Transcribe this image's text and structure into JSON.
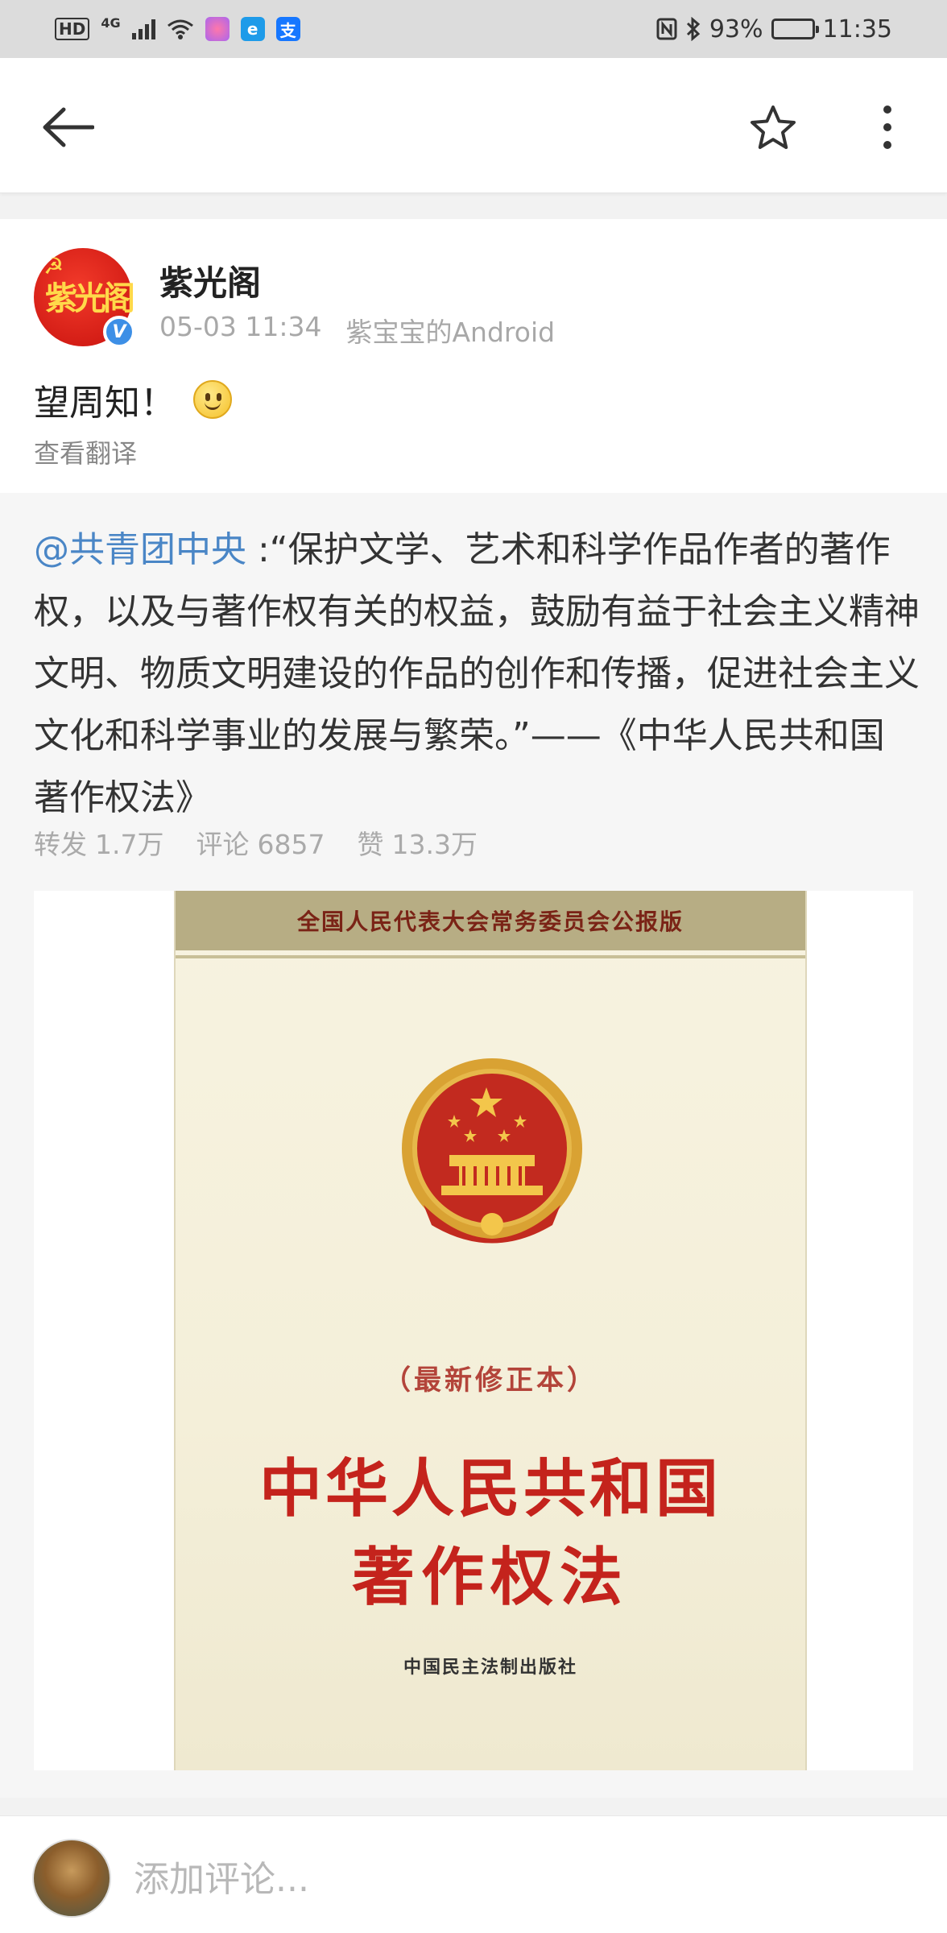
{
  "status_bar": {
    "hd": "HD",
    "network": "4G",
    "battery": "93%",
    "battery_level": 0.93,
    "time": "11:35"
  },
  "nav": {
    "back_icon": "arrow-left-icon",
    "star_icon": "star-outline-icon",
    "more_icon": "more-vertical-icon"
  },
  "post": {
    "username": "紫光阁",
    "avatar_text": "紫光阁",
    "verified": "V",
    "timestamp": "05-03 11:34",
    "source": "紫宝宝的Android",
    "text": "望周知！",
    "translate": "查看翻译"
  },
  "repost": {
    "mention": "@共青团中央",
    "body": " :“保护文学、艺术和科学作品作者的著作权，以及与著作权有关的权益，鼓励有益于社会主义精神文明、物质文明建设的作品的创作和传播，促进社会主义文化和科学事业的发展与繁荣。”——《中华人民共和国著作权法》",
    "stats": {
      "repost_label": "转发",
      "repost_count": "1.7万",
      "comment_label": "评论",
      "comment_count": "6857",
      "like_label": "赞",
      "like_count": "13.3万"
    },
    "image": {
      "band_text": "全国人民代表大会常务委员会公报版",
      "edition": "（最新修正本）",
      "title_line1": "中华人民共和国",
      "title_line2": "著作权法",
      "publisher": "中国民主法制出版社"
    }
  },
  "comment": {
    "placeholder": "添加评论..."
  },
  "colors": {
    "link": "#4a86c6",
    "verified": "#3d8fe6",
    "book_red": "#c4231c"
  }
}
